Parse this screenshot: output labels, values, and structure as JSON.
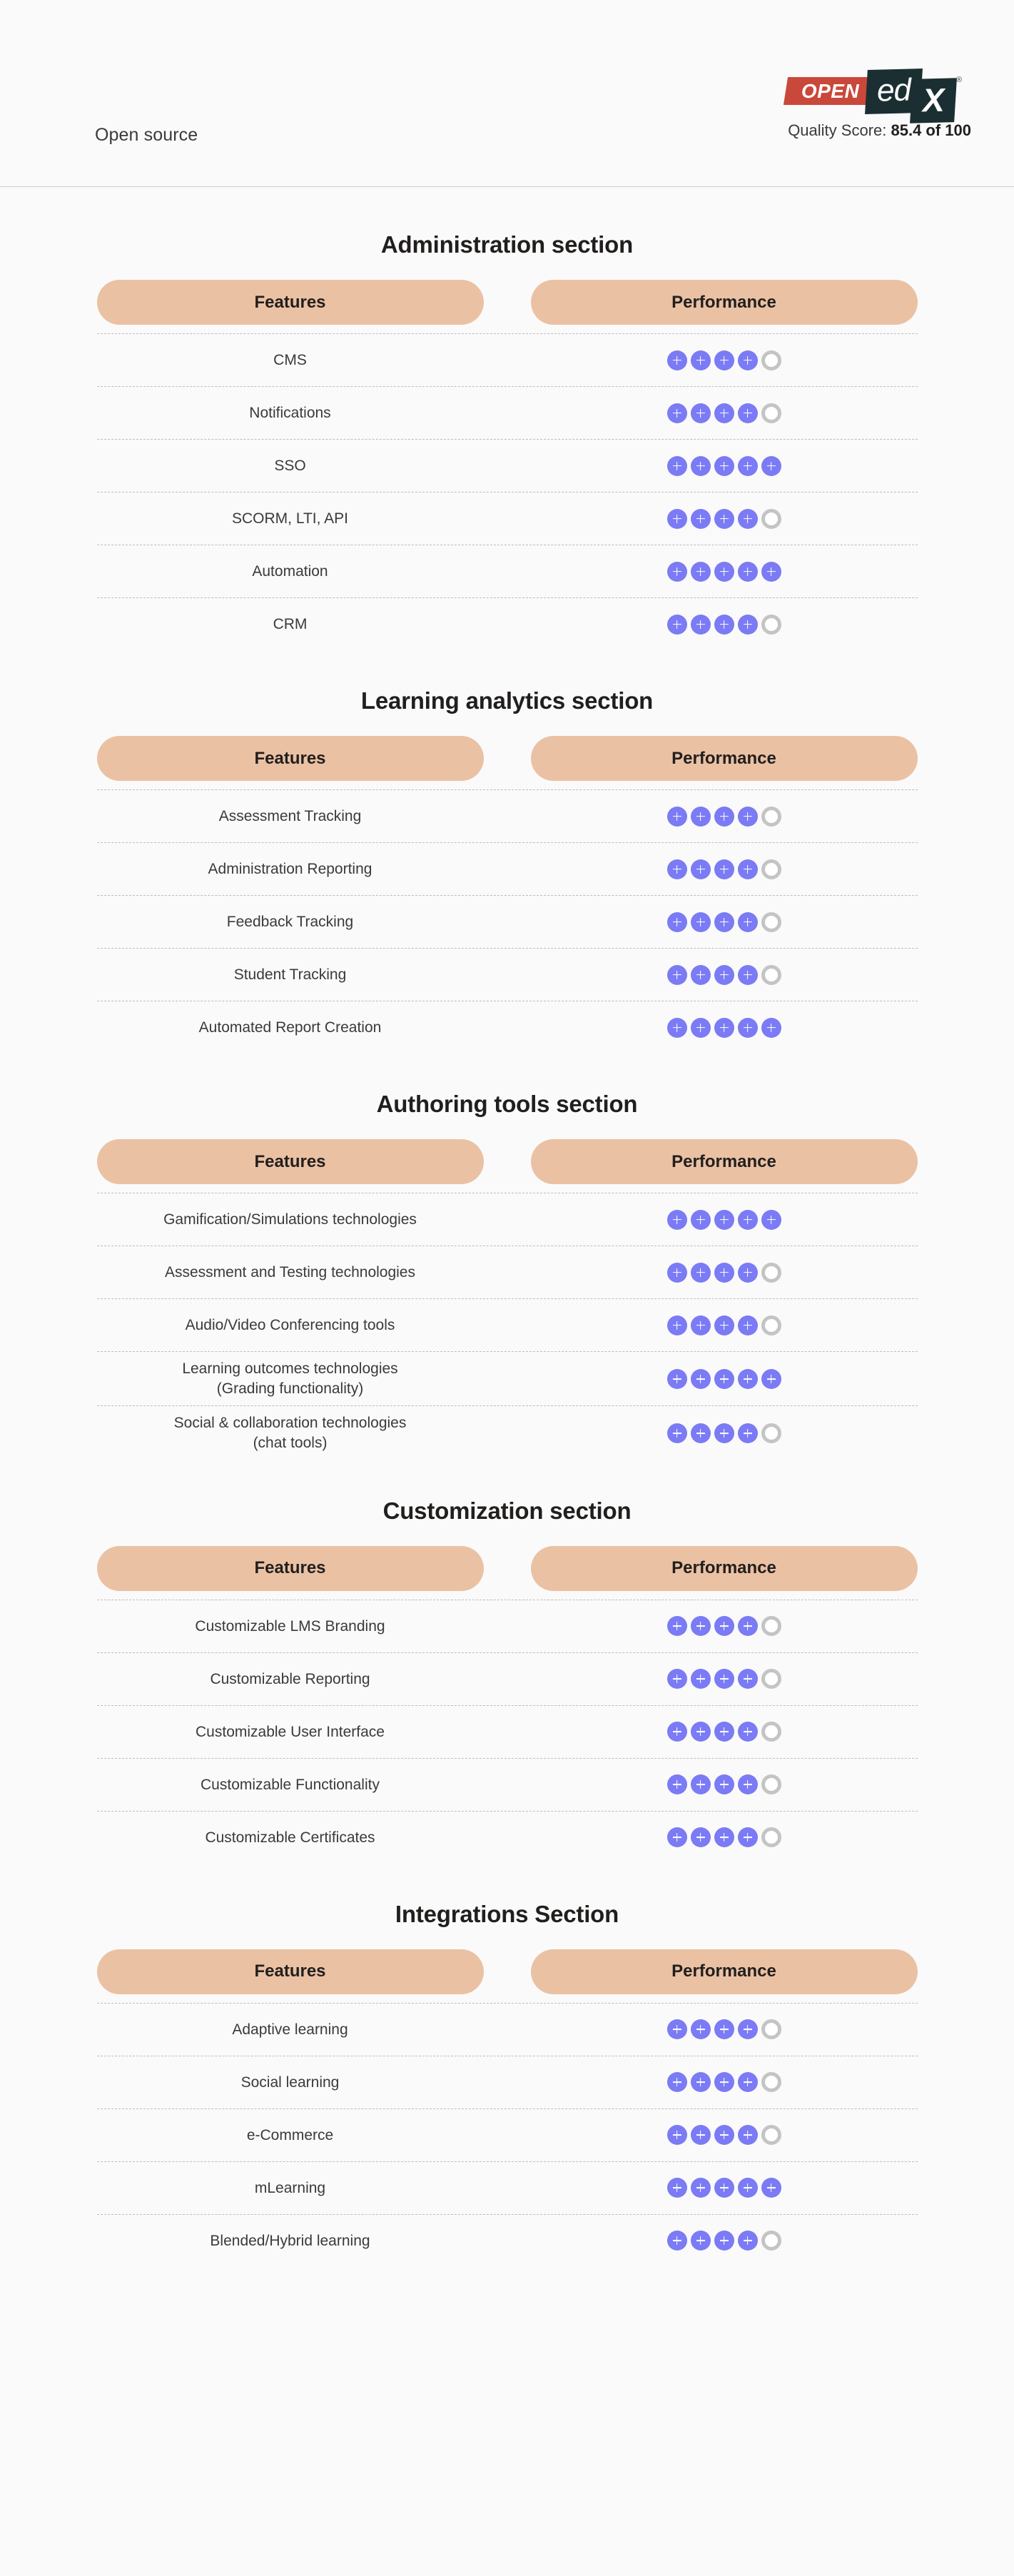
{
  "header": {
    "left_label": "Open source",
    "logo": {
      "open_text": "OPEN",
      "ed_text": "ed",
      "x_text": "X",
      "registered_mark": "®"
    },
    "quality_label": "Quality Score:",
    "quality_value": "85.4 of 100"
  },
  "columns": {
    "features": "Features",
    "performance": "Performance"
  },
  "max_rating": 5,
  "colors": {
    "header_pill": "#EBC1A4",
    "dot_filled": "#7B7BF5",
    "dot_empty": "#C4C4C4",
    "page_background": "#FAFAFA",
    "logo_red": "#C9483A",
    "logo_dark": "#1B2F33",
    "text": "#3C3A38"
  },
  "sections": [
    {
      "title": "Administration section",
      "rows": [
        {
          "feature": "CMS",
          "rating": 4
        },
        {
          "feature": "Notifications",
          "rating": 4
        },
        {
          "feature": "SSO",
          "rating": 5
        },
        {
          "feature": "SCORM, LTI, API",
          "rating": 4
        },
        {
          "feature": "Automation",
          "rating": 5
        },
        {
          "feature": "CRM",
          "rating": 4
        }
      ]
    },
    {
      "title": "Learning analytics section",
      "rows": [
        {
          "feature": "Assessment Tracking",
          "rating": 4
        },
        {
          "feature": "Administration Reporting",
          "rating": 4
        },
        {
          "feature": "Feedback Tracking",
          "rating": 4
        },
        {
          "feature": "Student Tracking",
          "rating": 4
        },
        {
          "feature": "Automated Report Creation",
          "rating": 5
        }
      ]
    },
    {
      "title": "Authoring tools section",
      "rows": [
        {
          "feature": "Gamification/Simulations technologies",
          "rating": 5
        },
        {
          "feature": "Assessment and Testing technologies",
          "rating": 4
        },
        {
          "feature": "Audio/Video Conferencing tools",
          "rating": 4
        },
        {
          "feature": "Learning outcomes technologies\n(Grading functionality)",
          "rating": 5
        },
        {
          "feature": "Social & collaboration technologies\n(chat tools)",
          "rating": 4
        }
      ]
    },
    {
      "title": "Customization section",
      "rows": [
        {
          "feature": "Customizable LMS Branding",
          "rating": 4
        },
        {
          "feature": "Customizable Reporting",
          "rating": 4
        },
        {
          "feature": "Customizable User Interface",
          "rating": 4
        },
        {
          "feature": "Customizable Functionality",
          "rating": 4
        },
        {
          "feature": "Customizable Certificates",
          "rating": 4
        }
      ]
    },
    {
      "title": "Integrations Section",
      "rows": [
        {
          "feature": "Adaptive learning",
          "rating": 4
        },
        {
          "feature": "Social learning",
          "rating": 4
        },
        {
          "feature": "e-Commerce",
          "rating": 4
        },
        {
          "feature": "mLearning",
          "rating": 5
        },
        {
          "feature": "Blended/Hybrid learning",
          "rating": 4
        }
      ]
    }
  ]
}
